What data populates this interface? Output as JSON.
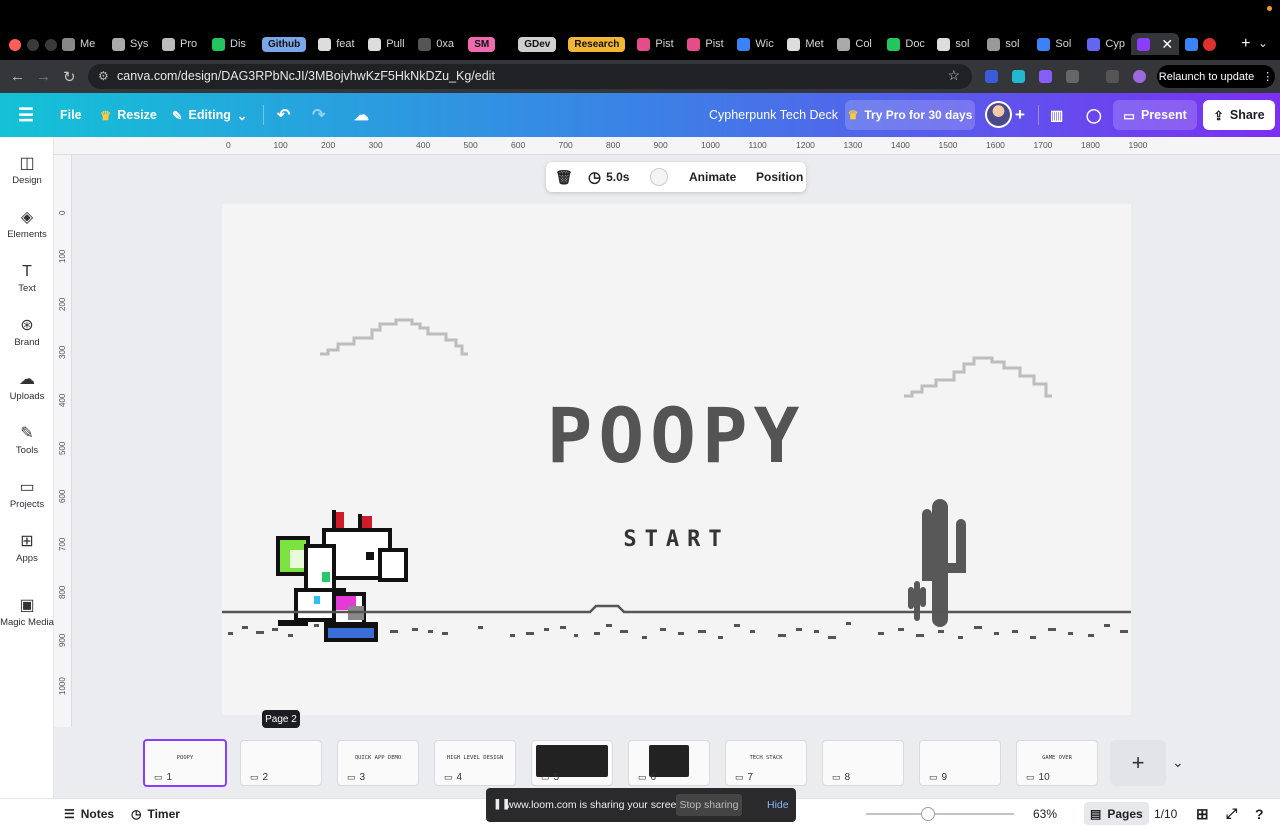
{
  "browser": {
    "tabs": [
      {
        "label": "Me",
        "color": "#888888"
      },
      {
        "label": "Sys",
        "color": "#aaaaaa"
      },
      {
        "label": "Pro",
        "color": "#bbbbbb"
      },
      {
        "label": "Dis",
        "color": "#22c55e"
      },
      {
        "label": "Github",
        "pill": true,
        "pill_color": "#7aa7e8"
      },
      {
        "label": "feat",
        "color": "#dddddd"
      },
      {
        "label": "Pull",
        "color": "#dddddd"
      },
      {
        "label": "0xa",
        "color": "#555555"
      },
      {
        "label": "SM",
        "pill": true,
        "pill_color": "#f06ab0"
      },
      {
        "label": "GDev",
        "pill": true,
        "pill_color": "#cfcfcf"
      },
      {
        "label": "Research",
        "pill": true,
        "pill_color": "#f2b632"
      },
      {
        "label": "Pist",
        "color": "#e44d8a"
      },
      {
        "label": "Pist",
        "color": "#e44d8a"
      },
      {
        "label": "Wic",
        "color": "#3b82f6"
      },
      {
        "label": "Met",
        "color": "#dddddd"
      },
      {
        "label": "Col",
        "color": "#aaaaaa"
      },
      {
        "label": "Doc",
        "color": "#22c55e"
      },
      {
        "label": "sol",
        "color": "#dddddd"
      },
      {
        "label": "sol",
        "color": "#999999"
      },
      {
        "label": "Sol",
        "color": "#3b82f6"
      },
      {
        "label": "Cyp",
        "color": "#6366f1"
      }
    ],
    "url": "canva.com/design/DAG3RPbNcJI/3MBojvhwKzF5HkNkDZu_Kg/edit",
    "relaunch_label": "Relaunch to update"
  },
  "header": {
    "file": "File",
    "resize": "Resize",
    "editing": "Editing",
    "doc_title": "Cypherpunk Tech Deck",
    "try_pro": "Try Pro for 30 days",
    "present": "Present",
    "share": "Share",
    "accent": "#8b3dff"
  },
  "sidebar": {
    "items": [
      {
        "label": "Design",
        "icon": "layout-icon"
      },
      {
        "label": "Elements",
        "icon": "shapes-icon"
      },
      {
        "label": "Text",
        "icon": "text-icon"
      },
      {
        "label": "Brand",
        "icon": "brand-icon"
      },
      {
        "label": "Uploads",
        "icon": "cloud-upload-icon"
      },
      {
        "label": "Tools",
        "icon": "pen-tool-icon"
      },
      {
        "label": "Projects",
        "icon": "folder-icon"
      },
      {
        "label": "Apps",
        "icon": "apps-icon"
      },
      {
        "label": "Magic Media",
        "icon": "magic-media-icon"
      }
    ]
  },
  "rulers": {
    "top": [
      "0",
      "100",
      "200",
      "300",
      "400",
      "500",
      "600",
      "700",
      "800",
      "900",
      "1000",
      "1100",
      "1200",
      "1300",
      "1400",
      "1500",
      "1600",
      "1700",
      "1800",
      "1900"
    ],
    "left": [
      "0",
      "100",
      "200",
      "300",
      "400",
      "500",
      "600",
      "700",
      "800",
      "900",
      "1000"
    ]
  },
  "floating_toolbar": {
    "duration": "5.0s",
    "animate": "Animate",
    "position": "Position"
  },
  "slide": {
    "title": "POOPY",
    "subtitle": "START"
  },
  "page_tooltip": "Page 2",
  "pages": [
    {
      "num": "1",
      "label": "POOPY",
      "selected": true
    },
    {
      "num": "2",
      "label": ""
    },
    {
      "num": "3",
      "label": "QUICK APP DEMO"
    },
    {
      "num": "4",
      "label": "HIGH LEVEL DESIGN"
    },
    {
      "num": "5",
      "label": ""
    },
    {
      "num": "6",
      "label": ""
    },
    {
      "num": "7",
      "label": "TECH STACK"
    },
    {
      "num": "8",
      "label": ""
    },
    {
      "num": "9",
      "label": ""
    },
    {
      "num": "10",
      "label": "GAME OVER"
    }
  ],
  "footer": {
    "notes": "Notes",
    "timer": "Timer",
    "zoom": "63%",
    "zoom_fraction": 0.42,
    "pages_label": "Pages",
    "page_count": "1/10"
  },
  "loom": {
    "message": "www.loom.com is sharing your screen.",
    "stop": "Stop sharing",
    "hide": "Hide"
  }
}
